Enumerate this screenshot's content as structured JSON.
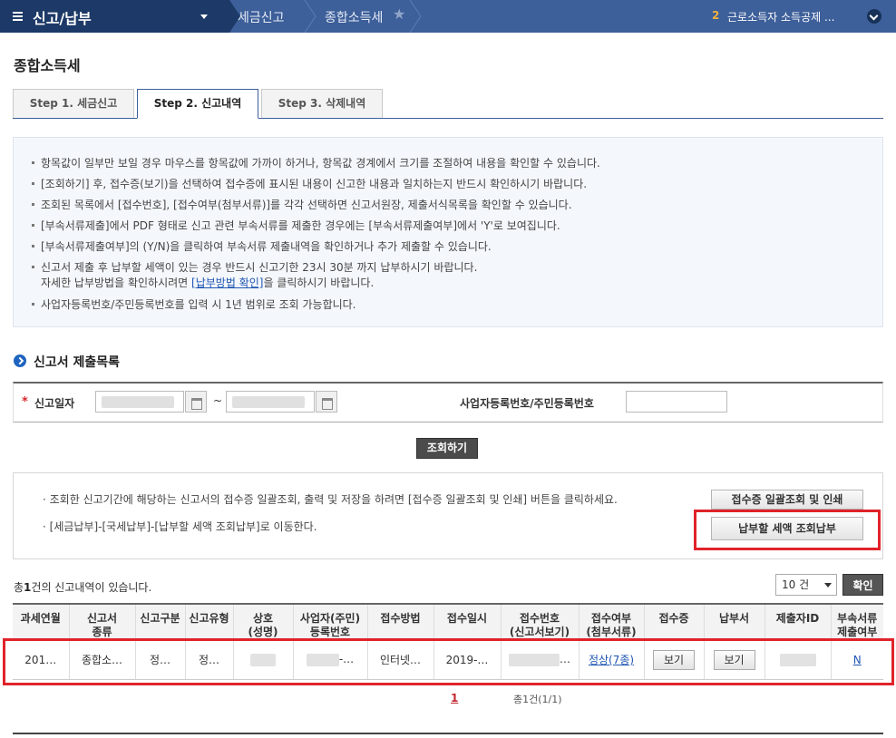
{
  "topbar": {
    "menu_title": "신고/납부",
    "breadcrumbs": [
      "세금신고",
      "종합소득세"
    ],
    "notice_count": "2",
    "notice_text": "근로소득자 소득공제 ..."
  },
  "page": {
    "title": "종합소득세"
  },
  "tabs": [
    {
      "label": "Step 1. 세금신고"
    },
    {
      "label": "Step 2. 신고내역"
    },
    {
      "label": "Step 3. 삭제내역"
    }
  ],
  "info": {
    "lines": [
      "항목값이 일부만 보일 경우 마우스를 항목값에 가까이 하거나, 항목값 경계에서 크기를 조절하여 내용을 확인할 수 있습니다.",
      "[조회하기] 후, 접수증(보기)을 선택하여 접수증에 표시된 내용이 신고한 내용과 일치하는지 반드시 확인하시기 바랍니다.",
      "조회된 목록에서 [접수번호], [접수여부(첨부서류)]를 각각 선택하면 신고서원장, 제출서식목록을 확인할 수 있습니다.",
      "[부속서류제출]에서 PDF 형태로 신고 관련 부속서류를 제출한 경우에는 [부속서류제출여부]에서 'Y'로 보여집니다.",
      "[부속서류제출여부]의 (Y/N)을 클릭하여 부속서류 제출내역을 확인하거나 추가 제출할 수 있습니다.",
      "신고서 제출 후 납부할 세액이 있는 경우 반드시 신고기한 23시 30분 까지 납부하시기 바랍니다."
    ],
    "line7_prefix": "자세한 납부방법을 확인하시려면 ",
    "line7_link": "[납부방법 확인]",
    "line7_suffix": "을 클릭하시기 바랍니다.",
    "line8": "사업자등록번호/주민등록번호를 입력 시 1년 범위로 조회 가능합니다."
  },
  "section": {
    "title": "신고서 제출목록"
  },
  "search": {
    "date_label": "신고일자",
    "tilde": "~",
    "bizno_label": "사업자등록번호/주민등록번호",
    "button": "조회하기"
  },
  "notice": {
    "line1": "조회한 신고기간에 해당하는 신고서의 접수증 일괄조회, 출력 및 저장을 하려면 [접수증 일괄조회 및 인쇄] 버튼을 클릭하세요.",
    "line2": "[세금납부]-[국세납부]-[납부할 세액 조회납부]로 이동한다.",
    "button1": "접수증 일괄조회 및 인쇄",
    "button2": "납부할 세액 조회납부"
  },
  "results": {
    "count_prefix": "총",
    "count": "1",
    "count_suffix": "건의 신고내역이 있습니다.",
    "page_size": "10 건",
    "confirm": "확인",
    "headers": [
      [
        "과세연월",
        ""
      ],
      [
        "신고서",
        "종류"
      ],
      [
        "신고구분",
        ""
      ],
      [
        "신고유형",
        ""
      ],
      [
        "상호",
        "(성명)"
      ],
      [
        "사업자(주민)",
        "등록번호"
      ],
      [
        "접수방법",
        ""
      ],
      [
        "접수일시",
        ""
      ],
      [
        "접수번호",
        "(신고서보기)"
      ],
      [
        "접수여부",
        "(첨부서류)"
      ],
      [
        "접수증",
        ""
      ],
      [
        "납부서",
        ""
      ],
      [
        "제출자ID",
        ""
      ],
      [
        "부속서류",
        "제출여부"
      ]
    ],
    "row": {
      "period": "201…",
      "form_type": "종합소…",
      "report_class": "정…",
      "report_type": "정…",
      "bizno_tail": "-…",
      "method": "인터넷…",
      "datetime": "2019-…",
      "receipt_no_tail": "…",
      "status": "정상(7종)",
      "receipt_btn": "보기",
      "payment_btn": "보기",
      "attach": "N"
    },
    "pager": {
      "current": "1",
      "info": "총1건(1/1)"
    }
  }
}
